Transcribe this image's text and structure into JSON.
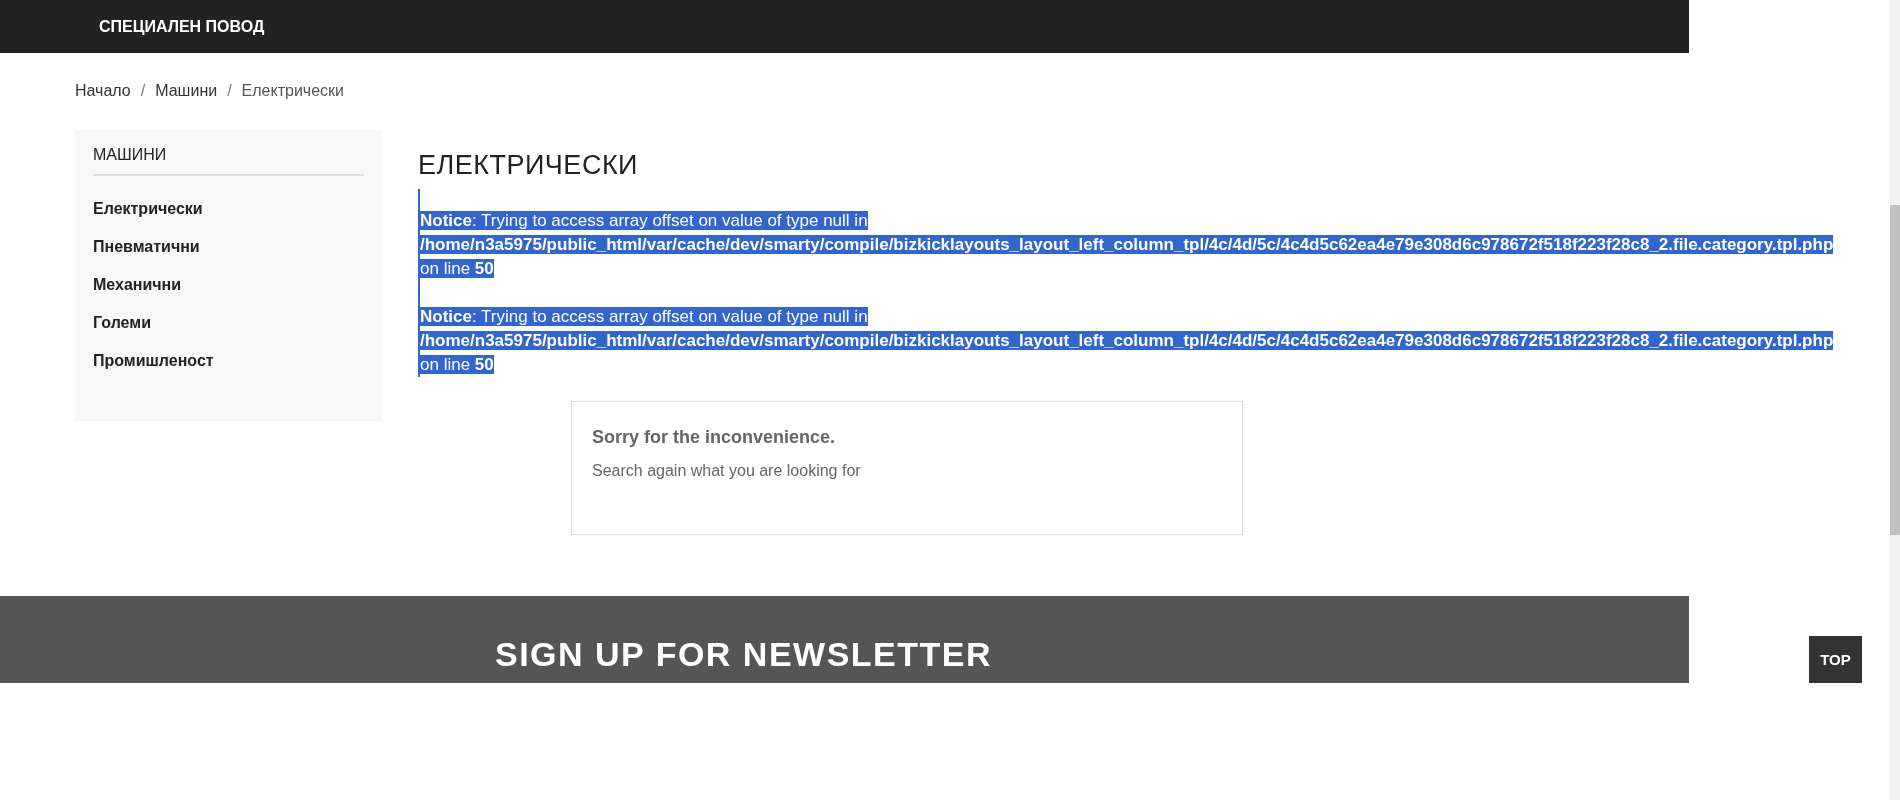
{
  "top_nav": {
    "items": [
      "СПЕЦИАЛЕН ПОВОД"
    ]
  },
  "breadcrumb": {
    "separator": "/",
    "items": [
      "Начало",
      "Машини",
      "Електрически"
    ]
  },
  "sidebar": {
    "title": "МАШИНИ",
    "items": [
      {
        "label": "Електрически"
      },
      {
        "label": "Пневматични"
      },
      {
        "label": "Механични"
      },
      {
        "label": "Големи"
      },
      {
        "label": "Промишленост"
      }
    ]
  },
  "content": {
    "heading": "ЕЛЕКТРИЧЕСКИ",
    "notices": [
      {
        "text": "**Notice**: Trying to access array offset on value of type null in **/home/n3a5975/public_html/var/cache/dev/smarty/compile/bizkicklayouts_layout_left_column_tpl/4c/4d/5c/4c4d5c62ea4e79e308d6c978672f518f223f28c8_2.file.category.tpl.php** on line **50**",
        "selected": true
      },
      {
        "text": "**Notice**: Trying to access array offset on value of type null in **/home/n3a5975/public_html/var/cache/dev/smarty/compile/bizkicklayouts_layout_left_column_tpl/4c/4d/5c/4c4d5c62ea4e79e308d6c978672f518f223f28c8_2.file.category.tpl.php** on line **50**",
        "selected": true
      }
    ],
    "empty_box": {
      "title": "Sorry for the inconvenience.",
      "text": "Search again what you are looking for"
    }
  },
  "newsletter": {
    "title": "SIGN UP FOR NEWSLETTER"
  },
  "top_button": {
    "label": "TOP"
  }
}
